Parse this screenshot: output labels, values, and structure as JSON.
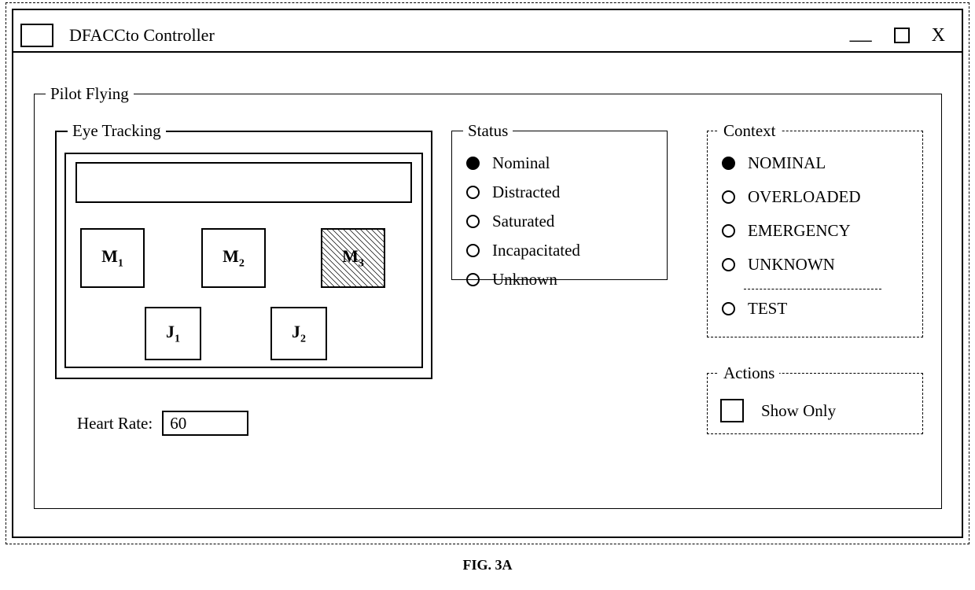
{
  "window": {
    "title": "DFACCto Controller"
  },
  "pilot": {
    "legend": "Pilot Flying",
    "eye": {
      "legend": "Eye Tracking",
      "m1_letter": "M",
      "m1_sub": "1",
      "m2_letter": "M",
      "m2_sub": "2",
      "m3_letter": "M",
      "m3_sub": "3",
      "j1_letter": "J",
      "j1_sub": "1",
      "j2_letter": "J",
      "j2_sub": "2"
    },
    "heart_rate": {
      "label": "Heart Rate:",
      "value": "60"
    },
    "status": {
      "legend": "Status",
      "selected": "Nominal",
      "options": [
        "Nominal",
        "Distracted",
        "Saturated",
        "Incapacitated",
        "Unknown"
      ]
    },
    "context": {
      "legend": "Context",
      "selected": "NOMINAL",
      "options_top": [
        "NOMINAL",
        "OVERLOADED",
        "EMERGENCY",
        "UNKNOWN"
      ],
      "option_below": "TEST"
    },
    "actions": {
      "legend": "Actions",
      "show_only_label": "Show Only",
      "show_only_checked": false
    }
  },
  "figure_caption": "FIG. 3A"
}
